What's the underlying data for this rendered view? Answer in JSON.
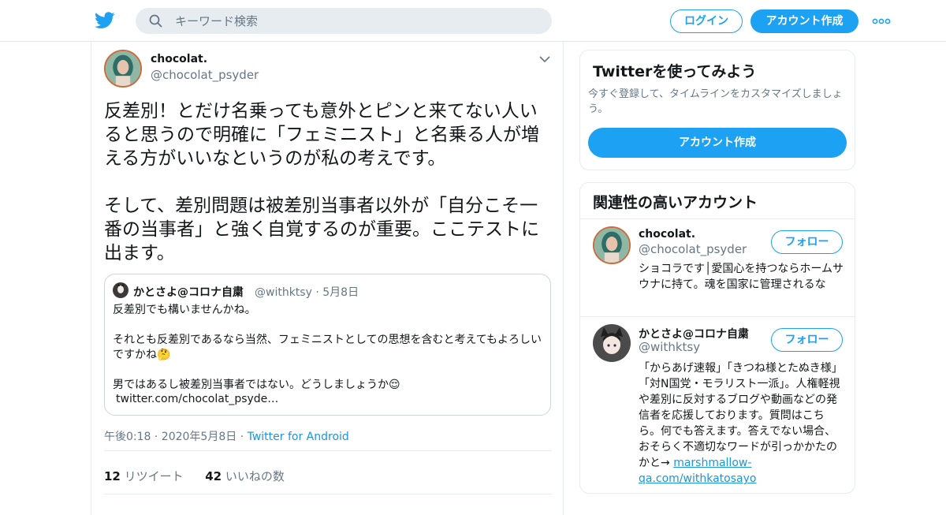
{
  "header": {
    "search_placeholder": "キーワード検索",
    "login_label": "ログイン",
    "signup_label": "アカウント作成",
    "brand_color": "#1da1f2"
  },
  "tweet": {
    "author_name": "chocolat.",
    "author_handle": "@chocolat_psyder",
    "text": "反差別！とだけ名乗っても意外とピンと来てない人いると思うので明確に「フェミニスト」と名乗る人が増える方がいいなというのが私の考えです。\n\nそして、差別問題は被差別当事者以外が「自分こそ一番の当事者」と強く自覚するのが重要。ここテストに出ます。",
    "quote": {
      "author_name": "かとさよ@コロナ自粛",
      "author_handle": "@withktsy",
      "date": "5月8日",
      "text": "反差別でも構いませんかね。\n\nそれとも反差別であるなら当然、フェミニストとしての思想を含むと考えてもよろしいですかね🤔\n\n男ではあるし被差別当事者ではない。どうしましょうか😌",
      "link": "twitter.com/chocolat_psyde…"
    },
    "timestamp": "午後0:18 · 2020年5月8日",
    "source": "Twitter for Android",
    "retweets": "12",
    "retweets_label": "リツイート",
    "likes": "42",
    "likes_label": "いいねの数"
  },
  "sidebar": {
    "promo": {
      "title": "Twitterを使ってみよう",
      "text": "今すぐ登録して、タイムラインをカスタマイズしましょう。",
      "cta": "アカウント作成"
    },
    "related": {
      "title": "関連性の高いアカウント",
      "follow_label": "フォロー",
      "accounts": [
        {
          "name": "chocolat.",
          "handle": "@chocolat_psyder",
          "bio": "ショコラです│愛国心を持つならホームサウナに持て。魂を国家に管理されるな"
        },
        {
          "name": "かとさよ@コロナ自粛",
          "handle": "@withktsy",
          "bio": "「からあげ速報」「きつね様とたぬき様」「対N国党・モラリスト一派」。人権軽視や差別に反対するブログや動画などの発信者を応援しております。質問はこちら。何でも答えます。答えでない場合、おそらく不適切なワードが引っかかたのかと→ ",
          "bio_link": "marshmallow-qa.com/withkatosayo"
        }
      ]
    }
  }
}
